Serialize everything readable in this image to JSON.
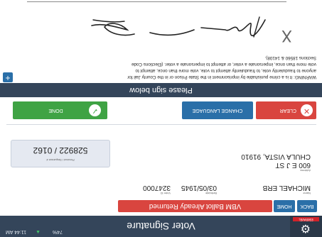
{
  "header": {
    "title": "Voter Signature",
    "battery": "74%",
    "clock": "11:44 AM",
    "brand_label": "ESKRAVEL"
  },
  "nav": {
    "back_label": "BACK",
    "home_label": "HOME",
    "vbm_label": "VBM Ballot Already Returned"
  },
  "voter": {
    "name_label": "Name",
    "name": "MICHAEL ERB",
    "address_label": "Address",
    "address_line1": "600 E J ST",
    "address_line2": "CHULA VISTA, 91910",
    "birthdate_label": "Birthdate",
    "birthdate": "03/05/1945",
    "voter_id_label": "Voter ID",
    "voter_id": "3247000",
    "precinct_label": "Precinct / Sequence #",
    "precinct": "528922 / 0162"
  },
  "actions": {
    "clear_label": "CLEAR",
    "change_language_label": "CHANGE LANGUAGE",
    "done_label": "DONE"
  },
  "signature": {
    "prompt": "Please sign below",
    "warning_line1": "WARNING: It is a crime punishable by imprisonment in the State Prison or in the County Jail for",
    "warning_line2": "anyone to fraudulently vote, to fraudulently attempt to vote, vote more than once, attempt to",
    "warning_line3": "vote more than once, impersonate a voter, or attempt to impersonate a voter. (Elections Code",
    "warning_line4": "Sections 18560 & 14108).",
    "x_mark": "X",
    "plus_label": "+"
  },
  "colors": {
    "header_bg": "#34455a",
    "primary_button": "#2a6fa8",
    "danger_button": "#d9453f",
    "success_button": "#3fa344"
  },
  "icons": [
    "gear-icon",
    "wifi-signal-icon",
    "close-circle-icon",
    "check-circle-icon",
    "plus-icon"
  ]
}
